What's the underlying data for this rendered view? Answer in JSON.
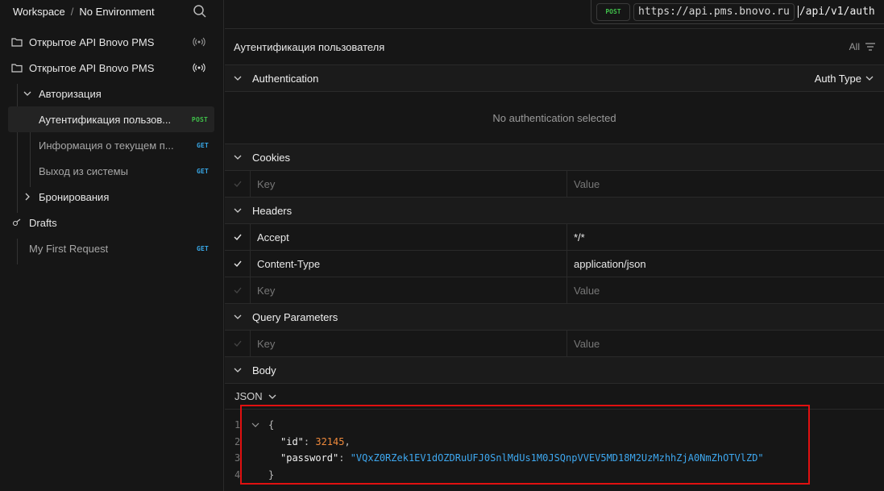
{
  "workspace": {
    "title": "Workspace",
    "separator": "/",
    "environment": "No Environment"
  },
  "sidebar": {
    "items": [
      {
        "label": "Открытое API Bnovo PMS"
      },
      {
        "label": "Открытое API Bnovo PMS"
      },
      {
        "label": "Авторизация"
      },
      {
        "label": "Аутентификация пользов...",
        "method": "POST"
      },
      {
        "label": "Информация о текущем п...",
        "method": "GET"
      },
      {
        "label": "Выход из системы",
        "method": "GET"
      },
      {
        "label": "Бронирования"
      },
      {
        "label": "Drafts"
      },
      {
        "label": "My First Request",
        "method": "GET"
      }
    ]
  },
  "request": {
    "method": "POST",
    "base_url": "https://api.pms.bnovo.ru",
    "path": "/api/v1/auth",
    "title": "Аутентификация пользователя",
    "filter_label": "All"
  },
  "authentication": {
    "title": "Authentication",
    "type_label": "Auth Type",
    "empty_text": "No authentication selected"
  },
  "cookies": {
    "title": "Cookies",
    "key_placeholder": "Key",
    "value_placeholder": "Value"
  },
  "headers": {
    "title": "Headers",
    "rows": [
      {
        "key": "Accept",
        "value": "*/*"
      },
      {
        "key": "Content-Type",
        "value": "application/json"
      }
    ],
    "key_placeholder": "Key",
    "value_placeholder": "Value"
  },
  "query": {
    "title": "Query Parameters",
    "key_placeholder": "Key",
    "value_placeholder": "Value"
  },
  "body": {
    "title": "Body",
    "format": "JSON",
    "line_numbers": [
      "1",
      "2",
      "3",
      "4"
    ],
    "open_brace": "{",
    "close_brace": "}",
    "id_key": "\"id\"",
    "id_value": "32145",
    "password_key": "\"password\"",
    "password_value": "\"VQxZ0RZek1EV1dOZDRuUFJ0SnlMdUs1M0JSQnpVVEV5MD18M2UzMzhhZjA0NmZhOTVlZD\""
  },
  "colors": {
    "post": "#3fbf4a",
    "get": "#38a8e8",
    "highlight": "#e01010",
    "number": "#f08a3c",
    "string": "#3ea8f0"
  }
}
